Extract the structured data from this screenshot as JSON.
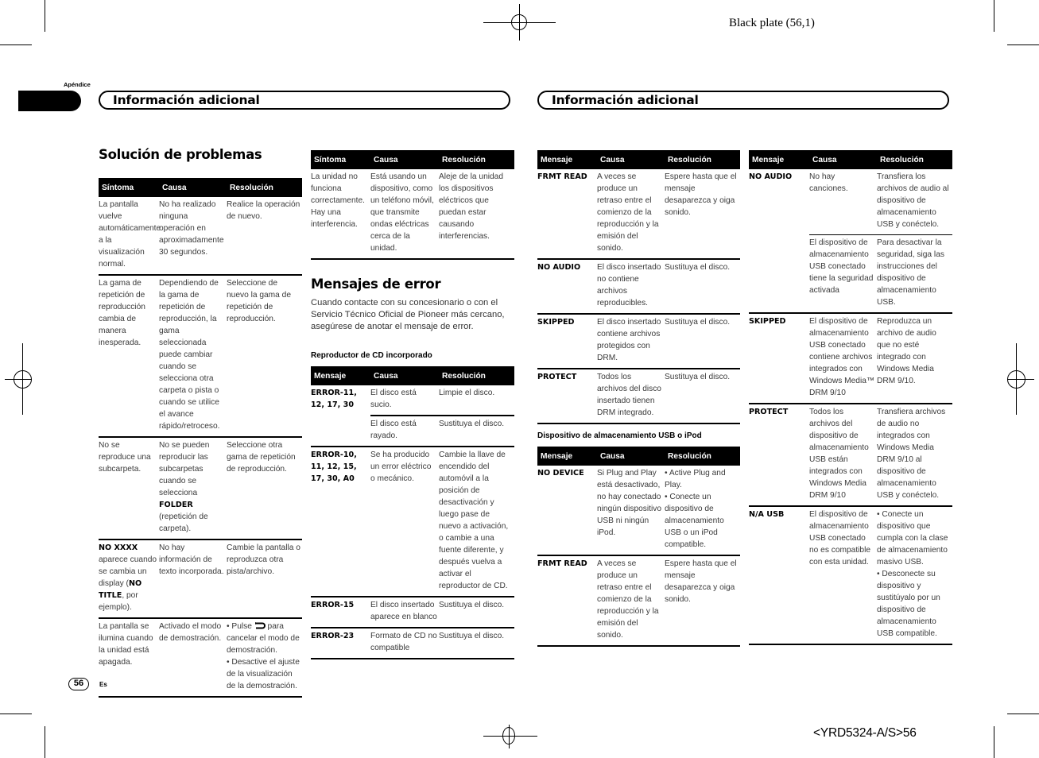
{
  "print_marks": {
    "plate": "Black plate (56,1)",
    "job_code": "<YRD5324-A/S>56"
  },
  "header": {
    "appendix_label": "Apéndice",
    "section_left": "Información adicional",
    "section_right": "Información adicional"
  },
  "troubleshooting": {
    "title": "Solución de problemas",
    "columns": [
      "Síntoma",
      "Causa",
      "Resolución"
    ],
    "rows": [
      {
        "symptom": "La pantalla vuelve automáticamente a la visualización normal.",
        "cause": "No ha realizado ninguna operación en aproximadamente 30 segundos.",
        "resolution": "Realice la operación de nuevo."
      },
      {
        "symptom": "La gama de repetición de reproducción cambia de manera inesperada.",
        "cause": "Dependiendo de la gama de repetición de reproducción, la gama seleccionada puede cambiar cuando se selecciona otra carpeta o pista o cuando se utilice el avance rápido/retroceso.",
        "resolution": "Seleccione de nuevo la gama de repetición de reproducción."
      },
      {
        "symptom": "No se reproduce una subcarpeta.",
        "cause_pre": "No se pueden reproducir las subcarpetas cuando se selecciona ",
        "cause_bold": "FOLDER",
        "cause_post": " (repetición de carpeta).",
        "resolution": "Seleccione otra gama de repetición de reproducción."
      },
      {
        "symptom_bold": "NO XXXX",
        "symptom_pre": " aparece cuando se cambia un display (",
        "symptom_bold2": "NO TITLE",
        "symptom_post": ", por ejemplo).",
        "cause": "No hay información de texto incorporada.",
        "resolution": "Cambie la pantalla o reproduzca otra pista/archivo."
      },
      {
        "symptom": "La pantalla se ilumina cuando la unidad está apagada.",
        "cause": "Activado el modo de demostración.",
        "resolution_1_pre": "• Pulse ",
        "resolution_1_icon": "back-arrow-icon",
        "resolution_1_post": " para cancelar el modo de demostración.",
        "resolution_2": "• Desactive el ajuste de la visualización de la demostración."
      }
    ],
    "continued": {
      "columns": [
        "Síntoma",
        "Causa",
        "Resolución"
      ],
      "rows": [
        {
          "symptom": "La unidad no funciona correctamente. Hay una interferencia.",
          "cause": "Está usando un dispositivo, como un teléfono móvil, que transmite ondas eléctricas cerca de la unidad.",
          "resolution": "Aleje de la unidad los dispositivos eléctricos que puedan estar causando interferencias."
        }
      ]
    }
  },
  "error_messages": {
    "title": "Mensajes de error",
    "intro": "Cuando contacte con su concesionario o con el Servicio Técnico Oficial de Pioneer más cercano, asegúrese de anotar el mensaje de error.",
    "cd_section": {
      "title": "Reproductor de CD incorporado",
      "columns": [
        "Mensaje",
        "Causa",
        "Resolución"
      ],
      "rows": [
        {
          "message": "ERROR-11, 12, 17, 30",
          "cause": "El disco está sucio.",
          "resolution": "Limpie el disco."
        },
        {
          "message": "",
          "cause": "El disco está rayado.",
          "resolution": "Sustituya el disco."
        },
        {
          "message": "ERROR-10, 11, 12, 15, 17, 30, A0",
          "cause": "Se ha producido un error eléctrico o mecánico.",
          "resolution": "Cambie la llave de encendido del automóvil a la posición de desactivación y luego pase de nuevo a activación, o cambie a una fuente diferente, y después vuelva a activar el reproductor de CD."
        },
        {
          "message": "ERROR-15",
          "cause": "El disco insertado aparece en blanco",
          "resolution": "Sustituya el disco."
        },
        {
          "message": "ERROR-23",
          "cause": "Formato de CD no compatible",
          "resolution": "Sustituya el disco."
        }
      ],
      "continued": {
        "columns": [
          "Mensaje",
          "Causa",
          "Resolución"
        ],
        "rows": [
          {
            "message": "FRMT READ",
            "cause": "A veces se produce un retraso entre el comienzo de la reproducción y la emisión del sonido.",
            "resolution": "Espere hasta que el mensaje desaparezca y oiga sonido."
          },
          {
            "message": "NO AUDIO",
            "cause": "El disco insertado no contiene archivos reproducibles.",
            "resolution": "Sustituya el disco."
          },
          {
            "message": "SKIPPED",
            "cause": "El disco insertado contiene archivos protegidos con DRM.",
            "resolution": "Sustituya el disco."
          },
          {
            "message": "PROTECT",
            "cause": "Todos los archivos del disco insertado tienen DRM integrado.",
            "resolution": "Sustituya el disco."
          }
        ]
      }
    },
    "usb_section": {
      "title": "Dispositivo de almacenamiento USB o iPod",
      "columns": [
        "Mensaje",
        "Causa",
        "Resolución"
      ],
      "rows": [
        {
          "message": "NO DEVICE",
          "cause": "Si Plug and Play está desactivado, no hay conectado ningún dispositivo USB ni ningún iPod.",
          "resolution_1": "• Active Plug and Play.",
          "resolution_2": "• Conecte un dispositivo de almacenamiento USB o un iPod compatible."
        },
        {
          "message": "FRMT READ",
          "cause": "A veces se produce un retraso entre el comienzo de la reproducción y la emisión del sonido.",
          "resolution": "Espere hasta que el mensaje desaparezca y oiga sonido."
        }
      ],
      "continued": {
        "columns": [
          "Mensaje",
          "Causa",
          "Resolución"
        ],
        "rows": [
          {
            "message": "NO AUDIO",
            "cause": "No hay canciones.",
            "resolution": "Transfiera los archivos de audio al dispositivo de almacenamiento USB y conéctelo."
          },
          {
            "message": "",
            "cause": "El dispositivo de almacenamiento USB conectado tiene la seguridad activada",
            "resolution": "Para desactivar la seguridad, siga las instrucciones del dispositivo de almacenamiento USB."
          },
          {
            "message": "SKIPPED",
            "cause": "El dispositivo de almacenamiento USB conectado contiene archivos integrados con Windows Media™ DRM 9/10",
            "resolution": "Reproduzca un archivo de audio que no esté integrado con Windows Media DRM 9/10."
          },
          {
            "message": "PROTECT",
            "cause": "Todos los archivos del dispositivo de almacenamiento USB están integrados con Windows Media DRM 9/10",
            "resolution": "Transfiera archivos de audio no integrados con Windows Media DRM 9/10 al dispositivo de almacenamiento USB y conéctelo."
          },
          {
            "message": "N/A USB",
            "cause": "El dispositivo de almacenamiento USB conectado no es compatible con esta unidad.",
            "resolution_1": "• Conecte un dispositivo que cumpla con la clase de almacenamiento masivo USB.",
            "resolution_2": "• Desconecte su dispositivo y sustitúyalo por un dispositivo de almacenamiento USB compatible."
          }
        ]
      }
    }
  },
  "footer": {
    "page_number": "56",
    "language": "Es"
  }
}
